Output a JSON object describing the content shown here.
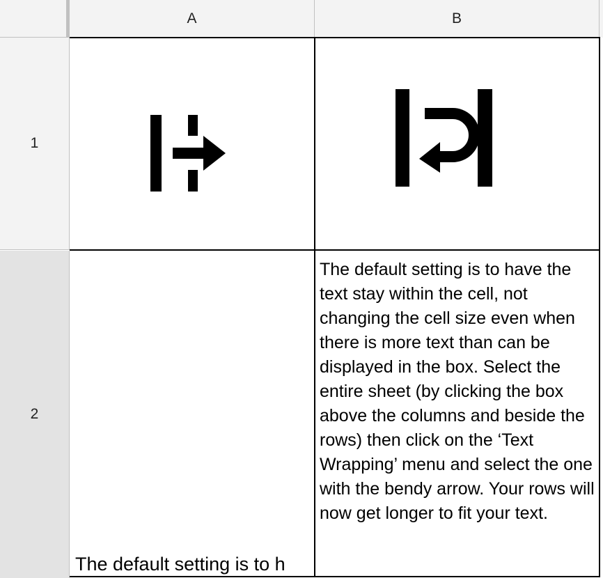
{
  "columns": [
    "A",
    "B"
  ],
  "rows": [
    "1",
    "2"
  ],
  "cells": {
    "A1": {
      "icon": "text-overflow-icon"
    },
    "B1": {
      "icon": "text-wrap-icon"
    },
    "A2": {
      "text": "The default setting is to h"
    },
    "B2": {
      "text": "The default setting is to have the text stay within the cell, not changing the cell size even when there is more text than can be displayed in the box. Select the entire sheet (by clicking the box above the columns and beside the rows) then click on the ‘Text Wrapping’ menu and select the one with the bendy arrow. Your rows will now get longer to fit your text."
    }
  },
  "colors": {
    "header_bg": "#f3f3f3",
    "selected_row_header_bg": "#e3e3e3",
    "grid_border": "#000000",
    "header_border": "#c0c0c0",
    "icon": "#000000"
  }
}
